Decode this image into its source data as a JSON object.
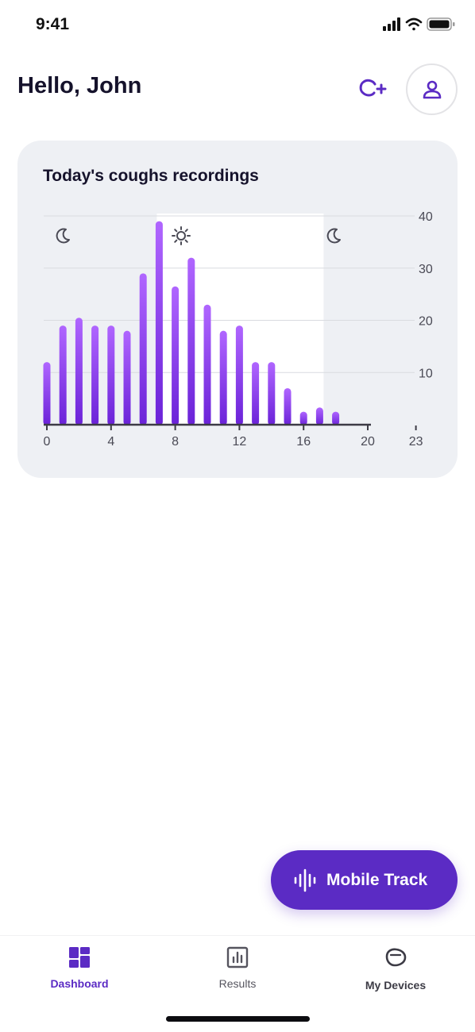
{
  "status_bar": {
    "time": "9:41"
  },
  "header": {
    "title": "Hello, John"
  },
  "chart_card": {
    "title": "Today's coughs recordings"
  },
  "chart_data": {
    "type": "bar",
    "title": "Today's coughs recordings",
    "x": [
      0,
      1,
      2,
      3,
      4,
      5,
      6,
      7,
      8,
      9,
      10,
      11,
      12,
      13,
      14,
      15,
      16,
      17,
      18
    ],
    "values": [
      12,
      19,
      20.5,
      19,
      19,
      18,
      29,
      39,
      26.5,
      32,
      23,
      18,
      19,
      12,
      12,
      7,
      2.5,
      3.3,
      2.5
    ],
    "x_ticks": [
      "0",
      "4",
      "8",
      "12",
      "16",
      "20",
      "23"
    ],
    "y_ticks": [
      "10",
      "20",
      "30",
      "40"
    ],
    "xlim": [
      0,
      23
    ],
    "ylim": [
      0,
      40
    ],
    "grid": true,
    "day_period": [
      7,
      17
    ],
    "night_icon": "moon-icon",
    "day_icon": "sun-icon",
    "bar_gradient": [
      "#b066ff",
      "#6a22d8"
    ]
  },
  "fab": {
    "label": "Mobile Track",
    "icon": "soundwave-icon"
  },
  "tabbar": {
    "tabs": [
      {
        "label": "Dashboard",
        "icon": "dashboard-icon",
        "active": true
      },
      {
        "label": "Results",
        "icon": "bar-chart-icon",
        "active": false
      },
      {
        "label": "My Devices",
        "icon": "device-icon",
        "active": false
      }
    ]
  },
  "colors": {
    "accent": "#5b2bc4",
    "card_bg": "#eef0f4",
    "text": "#15122b"
  }
}
